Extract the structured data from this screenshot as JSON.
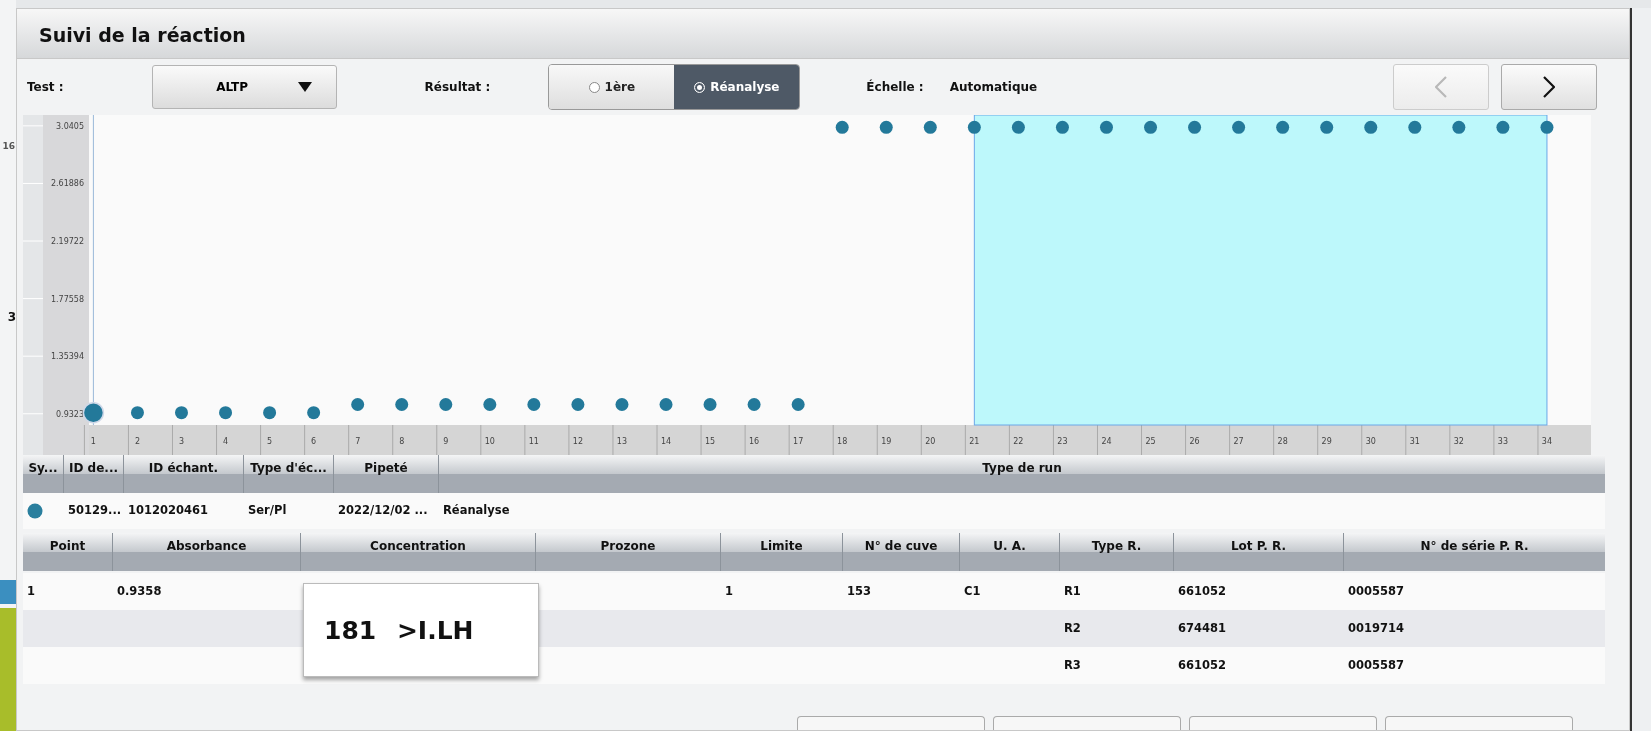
{
  "background": {
    "texts": [
      "16",
      "3"
    ]
  },
  "dialog": {
    "title": "Suivi de la réaction"
  },
  "toolbar": {
    "test_label": "Test :",
    "test_value": "ALTP",
    "result_label": "Résultat :",
    "result_options": [
      {
        "label": "1ère",
        "selected": false
      },
      {
        "label": "Réanalyse",
        "selected": true
      }
    ],
    "scale_label": "Échelle :",
    "scale_value": "Automatique",
    "nav": [
      {
        "kind": "prev",
        "disabled": true
      },
      {
        "kind": "next",
        "disabled": false
      }
    ]
  },
  "chart_data": {
    "type": "scatter",
    "x": [
      1,
      2,
      3,
      4,
      5,
      6,
      7,
      8,
      9,
      10,
      11,
      12,
      13,
      14,
      15,
      16,
      17,
      18,
      19,
      20,
      21,
      22,
      23,
      24,
      25,
      26,
      27,
      28,
      29,
      30,
      31,
      32,
      33,
      34
    ],
    "series": [
      {
        "color": "#23799a",
        "values": [
          null,
          0.94,
          0.94,
          0.94,
          0.94,
          0.94,
          1.0,
          1.0,
          1.0,
          1.0,
          1.0,
          1.0,
          1.0,
          1.0,
          1.0,
          1.0,
          1.0,
          3.03,
          3.03,
          3.03,
          3.03,
          3.03,
          3.03,
          3.03,
          3.03,
          3.03,
          3.03,
          3.03,
          3.03,
          3.03,
          3.03,
          3.03,
          3.03,
          3.03
        ]
      },
      {
        "color": "#23799a",
        "values": [
          0.94,
          null,
          null,
          null,
          null,
          null,
          null,
          null,
          null,
          null,
          null,
          null,
          null,
          null,
          null,
          null,
          null,
          null,
          null,
          null,
          null,
          null,
          null,
          null,
          null,
          null,
          null,
          null,
          null,
          null,
          null,
          null,
          null,
          null
        ]
      }
    ],
    "xlim": [
      0.9,
      35
    ],
    "ylim": [
      0.85,
      3.12
    ],
    "xticks": [
      1,
      2,
      3,
      4,
      5,
      6,
      7,
      8,
      9,
      10,
      11,
      12,
      13,
      14,
      15,
      16,
      17,
      18,
      19,
      20,
      21,
      22,
      23,
      24,
      25,
      26,
      27,
      28,
      29,
      30,
      31,
      32,
      33,
      34
    ],
    "yticks": [
      0.9323,
      1.35394,
      1.77558,
      2.19722,
      2.61886,
      3.0405
    ],
    "bands": [
      {
        "axis": "x",
        "from": 21,
        "to": 34
      }
    ],
    "ref_lines": [
      {
        "axis": "x",
        "value": 1
      }
    ]
  },
  "sample_table": {
    "columns": [
      "Sy...",
      "ID de...",
      "ID échant.",
      "Type d'éc...",
      "Pipeté",
      "Type de run"
    ],
    "rows": [
      {
        "cells": [
          "",
          "50129...",
          "1012020461",
          "Ser/Pl",
          "2022/12/02 ...",
          "Réanalyse"
        ]
      }
    ]
  },
  "point_table": {
    "columns": [
      "Point",
      "Absorbance",
      "Concentration",
      "Prozone",
      "Limite",
      "N° de cuve",
      "U. A.",
      "Type R.",
      "Lot P. R.",
      "N° de série P. R."
    ],
    "rows": [
      {
        "cells": [
          "1",
          "0.9358",
          "",
          "",
          "1",
          "153",
          "C1",
          "R1",
          "661052",
          "0005587"
        ]
      },
      {
        "cells": [
          "",
          "",
          "",
          "",
          "",
          "",
          "",
          "R2",
          "674481",
          "0019714"
        ]
      },
      {
        "cells": [
          "",
          "",
          "",
          "",
          "",
          "",
          "",
          "R3",
          "661052",
          "0005587"
        ]
      }
    ]
  },
  "tooltip": {
    "text": "181 >I.LH"
  }
}
